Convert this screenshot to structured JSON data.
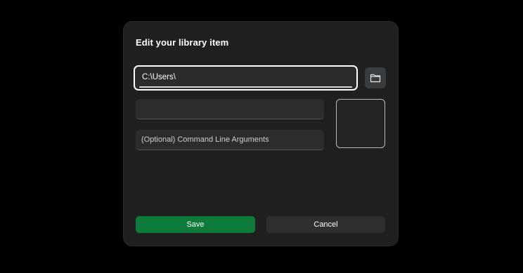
{
  "dialog": {
    "title": "Edit your library item",
    "path_input": {
      "value": "C:\\Users\\"
    },
    "browse_button": {
      "icon": "folder-icon"
    },
    "name_input": {
      "value": "",
      "placeholder": ""
    },
    "args_input": {
      "value": "",
      "placeholder": "(Optional) Command Line Arguments"
    },
    "save_label": "Save",
    "cancel_label": "Cancel"
  },
  "colors": {
    "background": "#000000",
    "dialog": "#202020",
    "save_accent": "#0e7a3b",
    "cancel": "#2d2f31",
    "focus_border": "#ffffff"
  }
}
